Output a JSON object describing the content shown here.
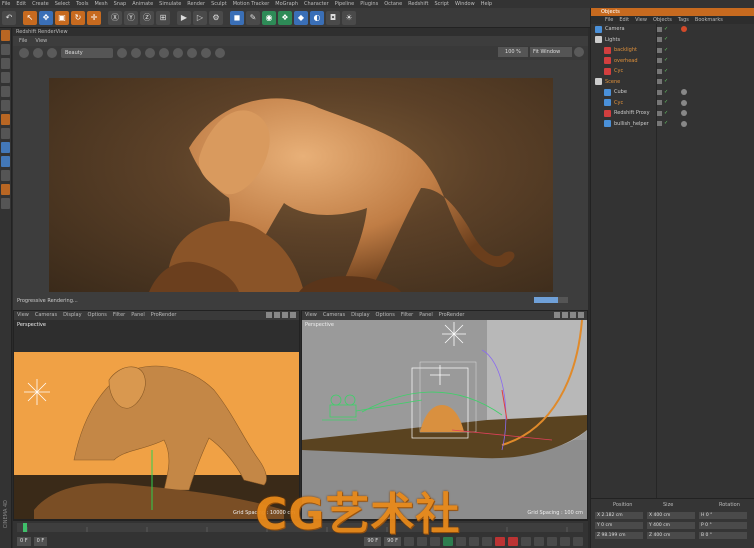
{
  "menubar": [
    "File",
    "Edit",
    "Create",
    "Select",
    "Tools",
    "Mesh",
    "Snap",
    "Animate",
    "Simulate",
    "Render",
    "Sculpt",
    "Motion Tracker",
    "MoGraph",
    "Character",
    "Pipeline",
    "Plugins",
    "Octane",
    "Redshift",
    "Script",
    "Window",
    "Help"
  ],
  "renderview": {
    "title": "Redshift RenderView",
    "menu": [
      "File",
      "View"
    ],
    "aov": "Beauty",
    "zoom": "100 %",
    "fit": "Fit Window",
    "progress_label": "Progressive Rendering...",
    "progress_fraction": 0.7
  },
  "viewport_left": {
    "menu": [
      "View",
      "Cameras",
      "Display",
      "Options",
      "Filter",
      "Panel",
      "ProRender"
    ],
    "label": "Perspective",
    "grid": "Grid Spacing : 10000 cm"
  },
  "viewport_right": {
    "menu": [
      "View",
      "Cameras",
      "Display",
      "Options",
      "Filter",
      "Panel",
      "ProRender"
    ],
    "label": "Perspective",
    "grid": "Grid Spacing : 100 cm"
  },
  "objects": {
    "header": "Objects",
    "menu": [
      "File",
      "Edit",
      "View",
      "Objects",
      "Tags",
      "Bookmarks"
    ],
    "rows": [
      {
        "name": "Camera",
        "indent": 0,
        "icon": "#4a90d9"
      },
      {
        "name": "Lights",
        "indent": 0,
        "icon": "#cccccc"
      },
      {
        "name": "backlight",
        "indent": 1,
        "icon": "#d33f3f",
        "orange": true
      },
      {
        "name": "overhead",
        "indent": 1,
        "icon": "#d33f3f",
        "orange": true
      },
      {
        "name": "Cyc",
        "indent": 1,
        "icon": "#d33f3f",
        "orange": true
      },
      {
        "name": "Scene",
        "indent": 0,
        "icon": "#cccccc",
        "orange": true
      },
      {
        "name": "Cube",
        "indent": 1,
        "icon": "#4a90d9"
      },
      {
        "name": "Cyc",
        "indent": 1,
        "icon": "#4a90d9",
        "orange": true
      },
      {
        "name": "Redshift Proxy",
        "indent": 1,
        "icon": "#d33f3f"
      },
      {
        "name": "bullish_helper",
        "indent": 1,
        "icon": "#4a90d9"
      }
    ]
  },
  "attributes": {
    "headers": [
      "Position",
      "Size",
      "Rotation"
    ],
    "rows": [
      [
        "X 2.182 cm",
        "X 400 cm",
        "H 0 °"
      ],
      [
        "Y 0 cm",
        "Y 400 cm",
        "P 0 °"
      ],
      [
        "Z 98.199 cm",
        "Z 400 cm",
        "B 0 °"
      ]
    ]
  },
  "timeline": {
    "start": "0 F",
    "current": "0 F",
    "end": "90 F",
    "end2": "90 F"
  },
  "left_strip_label": "CINEMA 4D",
  "watermark": "CG艺术社",
  "colors": {
    "accent": "#c76a1f",
    "bg": "#2b2b2b",
    "panel": "#3a3a3a"
  }
}
